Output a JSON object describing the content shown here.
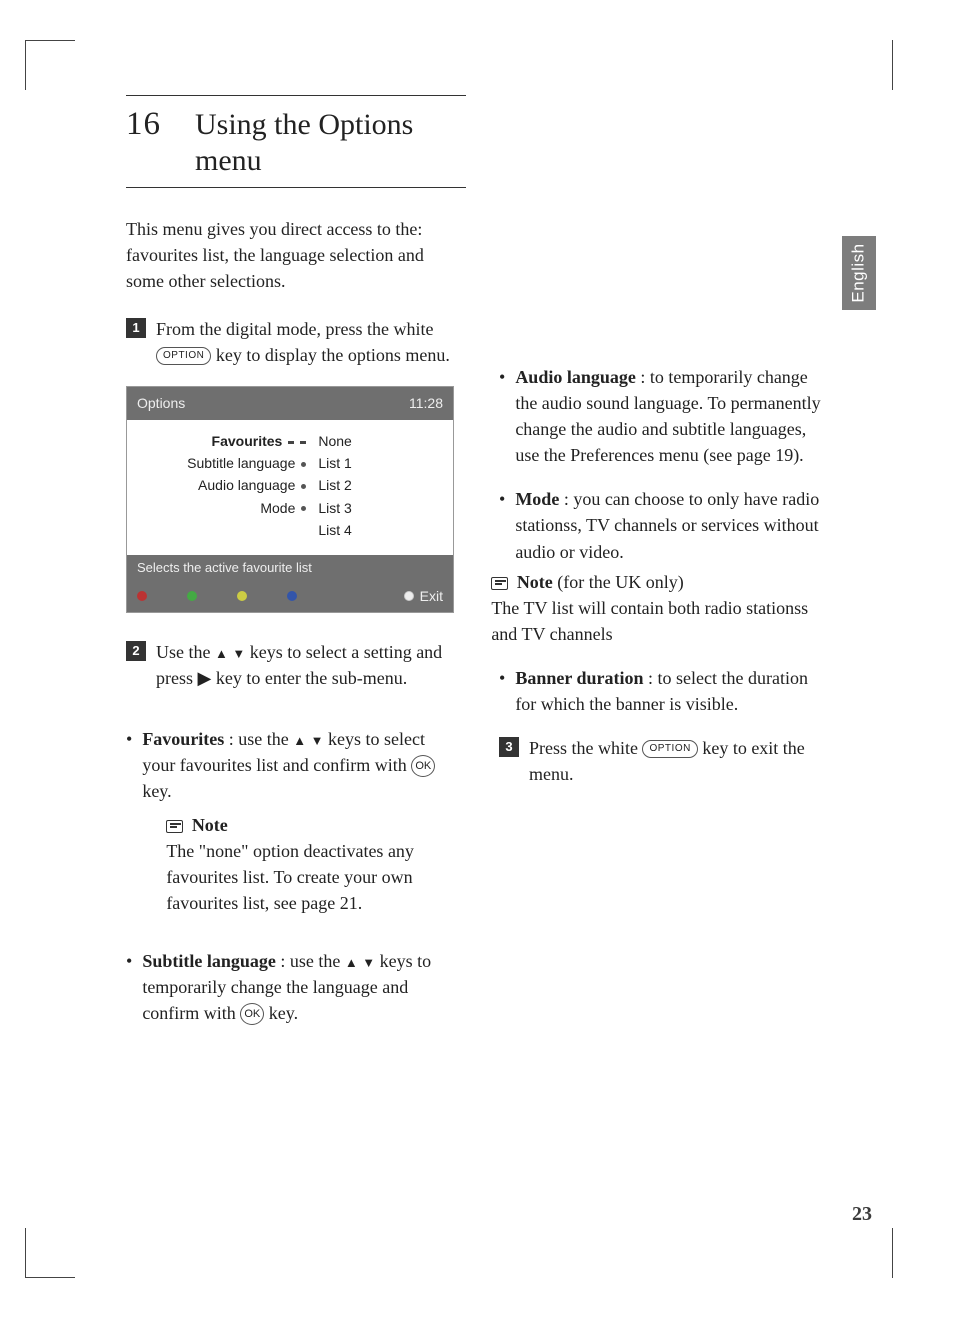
{
  "page_number": "23",
  "side_tab": "English",
  "heading": {
    "num": "16",
    "title": "Using the Options menu"
  },
  "intro": "This menu gives you direct access to the: favourites list, the language selection and some other selections.",
  "steps": {
    "s1": {
      "num": "1",
      "pre": "From the digital mode, press the white ",
      "key": "OPTION",
      "post": " key to display the options menu."
    },
    "s2": {
      "num": "2",
      "text_a": "Use the ",
      "text_b": " keys to select a setting and press ",
      "text_c": " key to enter the sub-menu."
    },
    "s3": {
      "num": "3",
      "pre": "Press the white ",
      "key": "OPTION",
      "post": " key to exit the menu."
    }
  },
  "tv": {
    "title": "Options",
    "time": "11:28",
    "rows": [
      "Favourites",
      "Subtitle language",
      "Audio language",
      "Mode"
    ],
    "options": [
      "None",
      "List 1",
      "List 2",
      "List 3",
      "List 4"
    ],
    "hint": "Selects the active favourite list",
    "exit": "Exit"
  },
  "bullets_left": {
    "fav": {
      "label": "Favourites",
      "rest": " : use the ",
      "rest2": " keys to select your favourites list and confirm with ",
      "ok": "OK",
      "rest3": " key."
    },
    "fav_note_head": "Note",
    "fav_note": "The \"none\" option deactivates any favourites list. To create your own favourites list, see page 21.",
    "sub": {
      "label": "Subtitle language",
      "rest": " : use the ",
      "rest2": " keys to temporarily change the language and confirm with ",
      "ok": "OK",
      "rest3": " key."
    }
  },
  "bullets_right": {
    "audio": {
      "label": "Audio language",
      "rest": " : to temporarily change the audio sound language. To permanently change the audio and subtitle languages, use the Preferences menu (see page 19)."
    },
    "mode": {
      "label": "Mode",
      "rest": " : you can choose to only have radio stationss, TV channels or services without audio or video."
    },
    "mode_note_head": "Note",
    "mode_note_label": " (for the UK only)",
    "mode_note": "The TV list will contain both radio stationss and TV channels",
    "banner": {
      "label": "Banner duration",
      "rest": " : to select the duration for which the banner is visible."
    }
  }
}
